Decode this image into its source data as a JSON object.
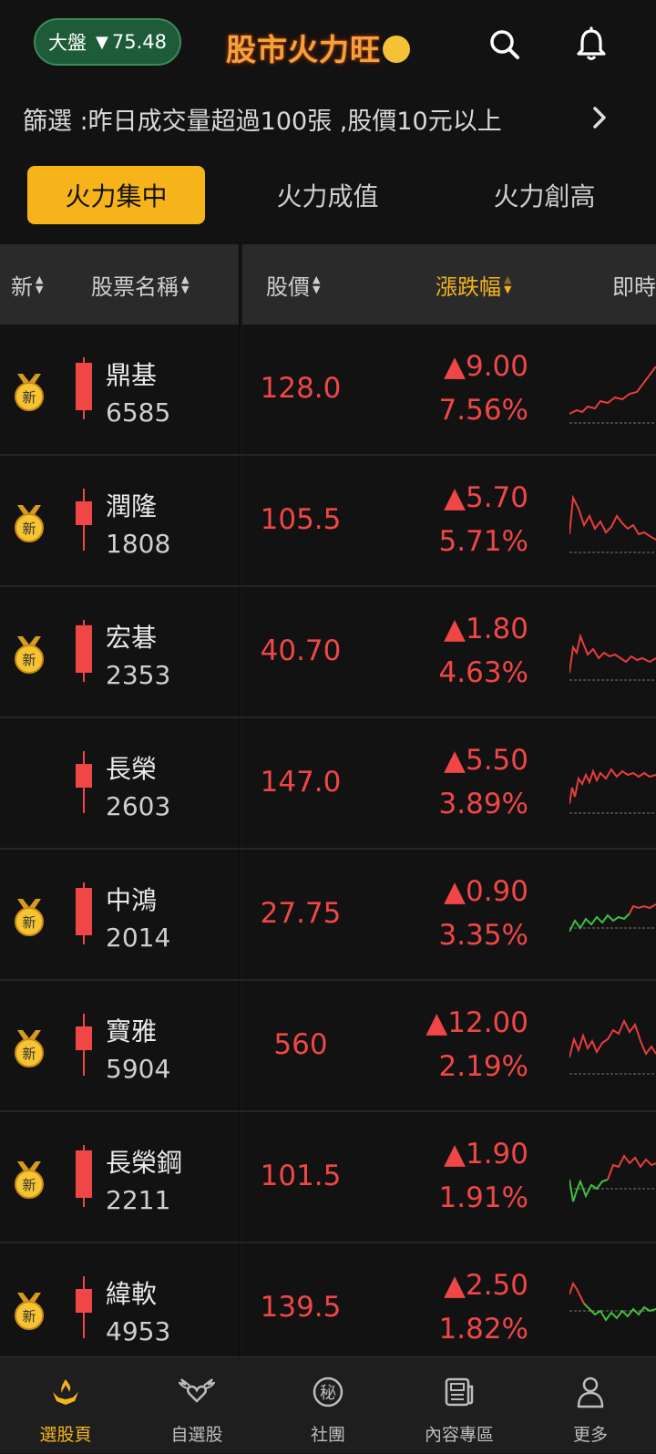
{
  "header": {
    "market_label": "大盤",
    "market_arrow": "▼",
    "market_value": "75.48",
    "app_title": "股市火力旺",
    "icons": [
      "search-icon",
      "bell-icon"
    ]
  },
  "filter": {
    "text": "篩選 :昨日成交量超過100張 ,股價10元以上"
  },
  "tabs": [
    {
      "label": "火力集中",
      "active": true
    },
    {
      "label": "火力成值",
      "active": false
    },
    {
      "label": "火力創高",
      "active": false
    }
  ],
  "columns": {
    "new": "新",
    "name": "股票名稱",
    "price": "股價",
    "change": "漲跌幅",
    "realtime": "即時"
  },
  "rows": [
    {
      "name": "鼎基",
      "code": "6585",
      "price": "128.0",
      "change": "▲9.00",
      "pct": "7.56%",
      "is_new": true
    },
    {
      "name": "潤隆",
      "code": "1808",
      "price": "105.5",
      "change": "▲5.70",
      "pct": "5.71%",
      "is_new": true
    },
    {
      "name": "宏碁",
      "code": "2353",
      "price": "40.70",
      "change": "▲1.80",
      "pct": "4.63%",
      "is_new": true
    },
    {
      "name": "長榮",
      "code": "2603",
      "price": "147.0",
      "change": "▲5.50",
      "pct": "3.89%",
      "is_new": false
    },
    {
      "name": "中鴻",
      "code": "2014",
      "price": "27.75",
      "change": "▲0.90",
      "pct": "3.35%",
      "is_new": true
    },
    {
      "name": "寶雅",
      "code": "5904",
      "price": "560",
      "change": "▲12.00",
      "pct": "2.19%",
      "is_new": true
    },
    {
      "name": "長榮鋼",
      "code": "2211",
      "price": "101.5",
      "change": "▲1.90",
      "pct": "1.91%",
      "is_new": true
    },
    {
      "name": "緯軟",
      "code": "4953",
      "price": "139.5",
      "change": "▲2.50",
      "pct": "1.82%",
      "is_new": true
    }
  ],
  "badge_text": "新",
  "nav": [
    {
      "label": "選股頁",
      "icon": "flame-hands-icon",
      "active": true
    },
    {
      "label": "自選股",
      "icon": "winged-heart-icon",
      "active": false
    },
    {
      "label": "社團",
      "icon": "secret-icon",
      "active": false
    },
    {
      "label": "內容專區",
      "icon": "newspaper-icon",
      "active": false
    },
    {
      "label": "更多",
      "icon": "person-icon",
      "active": false
    }
  ],
  "colors": {
    "accent": "#f5b41d",
    "up": "#f04646",
    "down": "#3fbf3f",
    "market_pill": "#1e5b38"
  }
}
